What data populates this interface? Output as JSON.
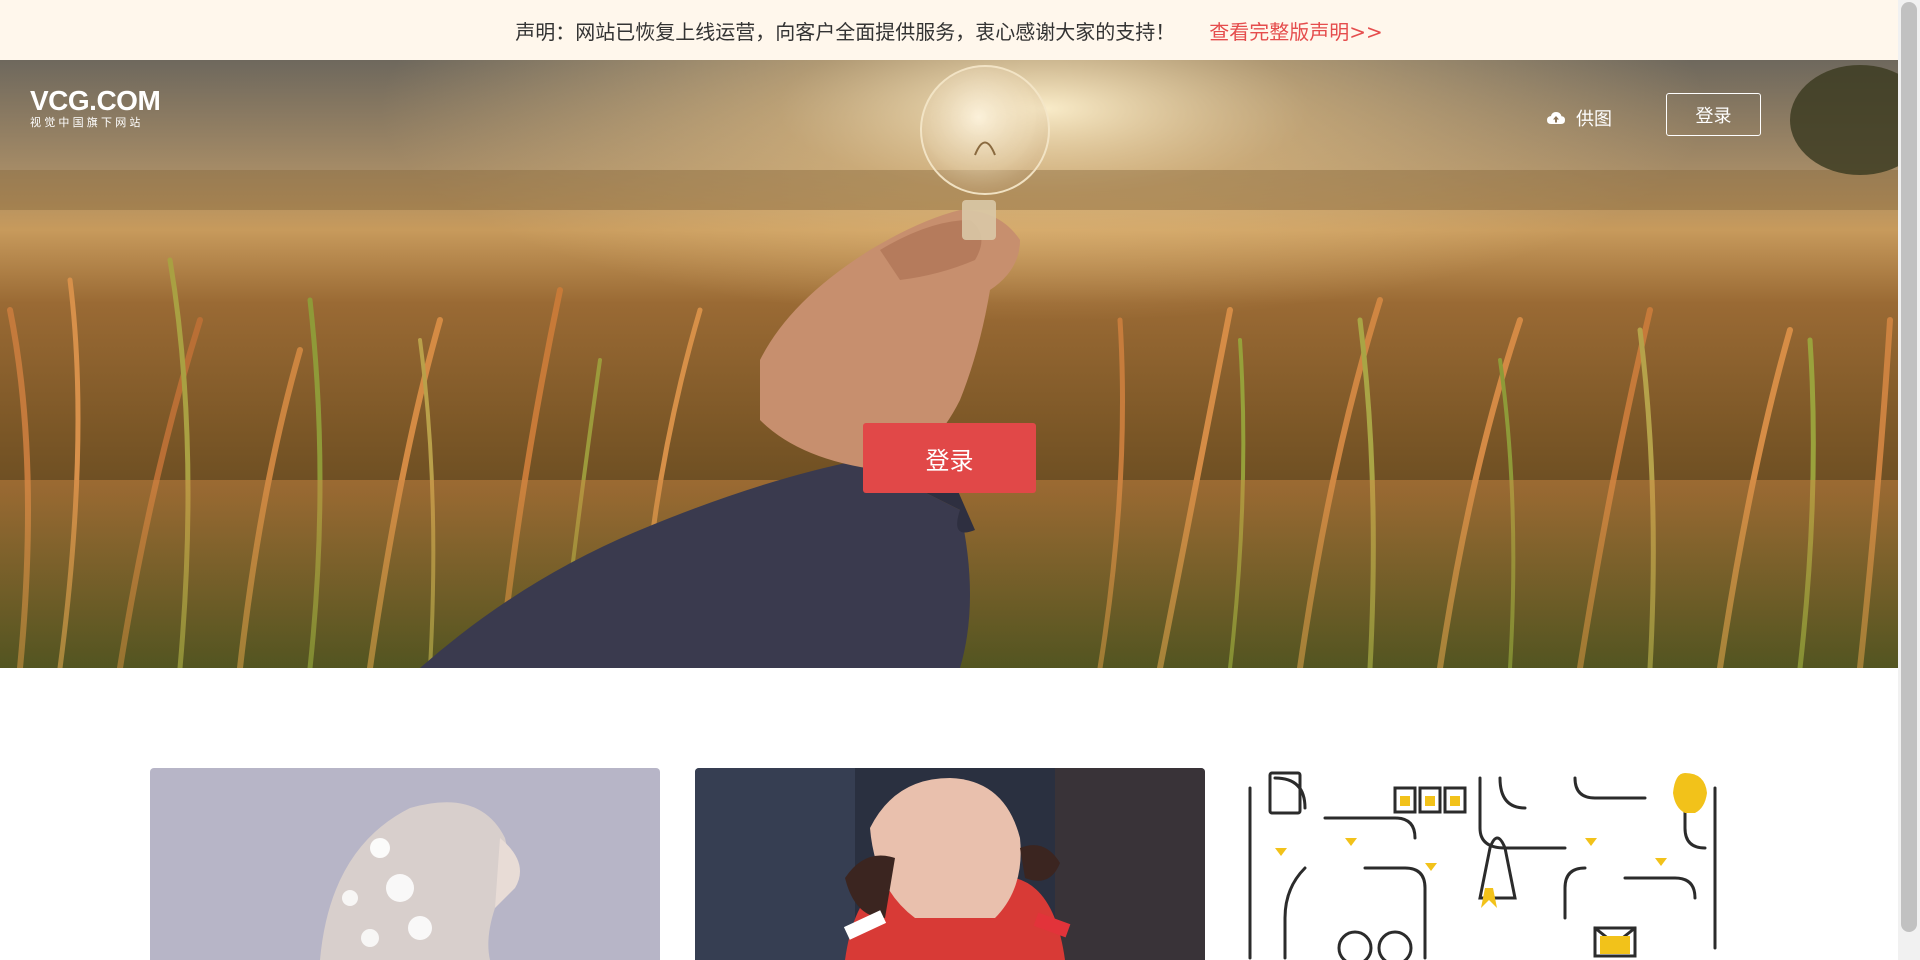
{
  "notice": {
    "text": "声明：网站已恢复上线运营，向客户全面提供服务，衷心感谢大家的支持！",
    "link_label": "查看完整版声明>>"
  },
  "header": {
    "logo_main": "VCG.COM",
    "logo_sub": "视觉中国旗下网站",
    "upload_label": "供图",
    "upload_icon": "cloud-upload-icon",
    "login_label": "登录"
  },
  "hero": {
    "login_label": "登录"
  },
  "colors": {
    "notice_bg": "#fff7ec",
    "notice_link": "#e54d4d",
    "primary_button": "#e14848"
  }
}
